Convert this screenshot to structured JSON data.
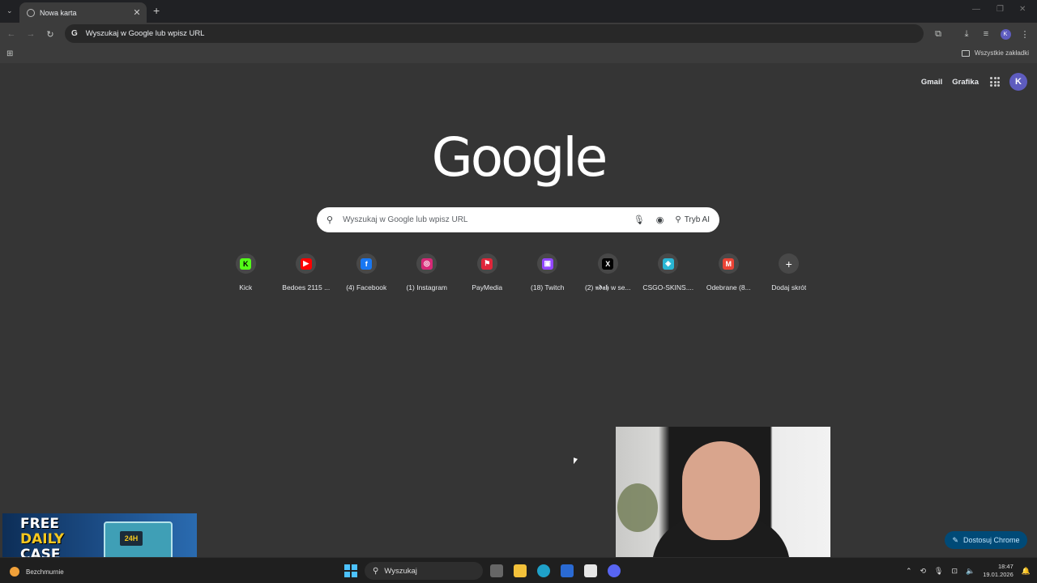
{
  "browser": {
    "tab_title": "Nowa karta",
    "omnibox_placeholder": "Wyszukaj w Google lub wpisz URL",
    "all_bookmarks_label": "Wszystkie zakładki",
    "profile_initial": "K"
  },
  "ntp": {
    "header_links": [
      "Gmail",
      "Grafika"
    ],
    "profile_initial": "K",
    "logo_text": "Google",
    "search_placeholder": "Wyszukaj w Google lub wpisz URL",
    "ai_mode_label": "Tryb AI",
    "shortcuts": [
      {
        "label": "Kick",
        "icon": "kick-icon",
        "color": "#53fc18",
        "glyph": "K"
      },
      {
        "label": "Bedoes 2115 ...",
        "icon": "youtube-icon",
        "color": "#ff0000",
        "glyph": "▶"
      },
      {
        "label": "(4) Facebook",
        "icon": "facebook-icon",
        "color": "#1877f2",
        "glyph": "f"
      },
      {
        "label": "(1) Instagram",
        "icon": "instagram-icon",
        "color": "#d62976",
        "glyph": "◎"
      },
      {
        "label": "PayMedia",
        "icon": "paymedia-icon",
        "color": "#e0263a",
        "glyph": "⚑"
      },
      {
        "label": "(18) Twitch",
        "icon": "twitch-icon",
        "color": "#9146ff",
        "glyph": "▣"
      },
      {
        "label": "(2) 𝖓𝖉𝖆𝖍 w se...",
        "icon": "x-icon",
        "color": "#000000",
        "glyph": "X"
      },
      {
        "label": "CSGO-SKINS....",
        "icon": "csgo-skins-icon",
        "color": "#29b6d4",
        "glyph": "◈"
      },
      {
        "label": "Odebrane (8...",
        "icon": "gmail-icon",
        "color": "#ea4335",
        "glyph": "M"
      },
      {
        "label": "Dodaj skrót",
        "icon": "plus-icon",
        "color": "#484848",
        "glyph": "+"
      }
    ],
    "customize_label": "Dostosuj Chrome"
  },
  "promo": {
    "line1": "FREE",
    "line2": "DAILY",
    "line3": "CASE",
    "badge": "24H"
  },
  "taskbar": {
    "weather_label": "Bezchmurnie",
    "search_label": "Wyszukaj",
    "time": "18:47",
    "date": "19.01.2026"
  }
}
